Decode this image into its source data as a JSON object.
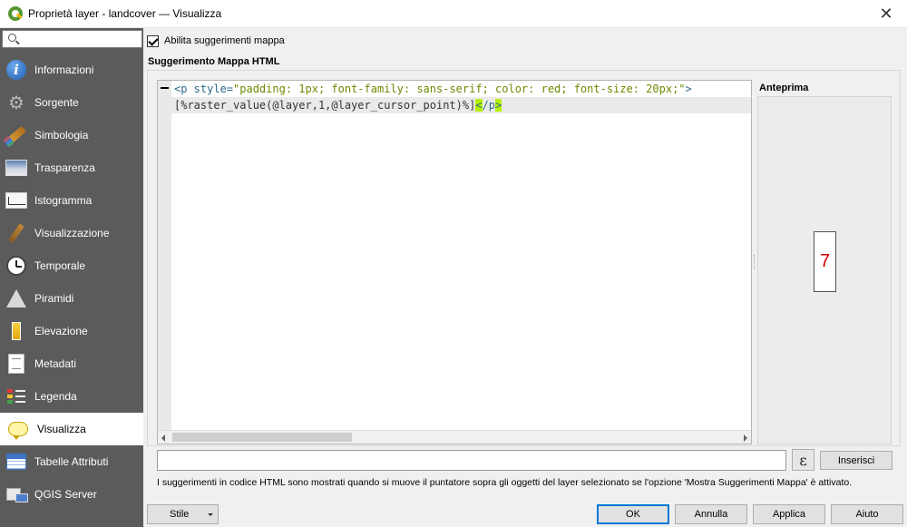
{
  "window": {
    "title": "Proprietà layer - landcover — Visualizza",
    "close_glyph": "✕"
  },
  "sidebar": {
    "search_placeholder": "",
    "items": [
      {
        "label": "Informazioni",
        "icon": "info-icon"
      },
      {
        "label": "Sorgente",
        "icon": "source-gear-icon"
      },
      {
        "label": "Simbologia",
        "icon": "symbology-brush-icon"
      },
      {
        "label": "Trasparenza",
        "icon": "transparency-icon"
      },
      {
        "label": "Istogramma",
        "icon": "histogram-icon"
      },
      {
        "label": "Visualizzazione",
        "icon": "rendering-broom-icon"
      },
      {
        "label": "Temporale",
        "icon": "clock-icon"
      },
      {
        "label": "Piramidi",
        "icon": "pyramid-icon"
      },
      {
        "label": "Elevazione",
        "icon": "elevation-icon"
      },
      {
        "label": "Metadati",
        "icon": "metadata-icon"
      },
      {
        "label": "Legenda",
        "icon": "legend-icon"
      },
      {
        "label": "Visualizza",
        "icon": "map-tip-bubble-icon",
        "active": true
      },
      {
        "label": "Tabelle Attributi",
        "icon": "attribute-table-icon"
      },
      {
        "label": "QGIS Server",
        "icon": "qgis-server-icon"
      }
    ]
  },
  "main": {
    "enable_maptips_label": "Abilita suggerimenti mappa",
    "enable_maptips_checked": true,
    "section_title": "Suggerimento Mappa HTML",
    "code": {
      "line1": {
        "tag_open": "<p",
        "attr": " style=",
        "value": "\"padding: 1px; font-family: sans-serif; color: red; font-size: 20px;\"",
        "tag_close": ">"
      },
      "line2": {
        "expr": "[%raster_value(@layer,1,@layer_cursor_point)%]",
        "close_bracket": "<",
        "close_rest": "/p",
        "close_end": ">"
      }
    },
    "preview": {
      "label": "Anteprima",
      "value": "7",
      "value_color": "#d10000"
    },
    "expression_button_glyph": "ε",
    "insert_button": "Inserisci",
    "help_text": "I suggerimenti in codice HTML sono mostrati quando si muove il puntatore sopra gli oggetti del layer selezionato se l'opzione 'Mostra Suggerimenti Mappa' è attivato."
  },
  "footer": {
    "style_button": "Stile",
    "ok": "OK",
    "cancel": "Annulla",
    "apply": "Applica",
    "help": "Aiuto"
  }
}
